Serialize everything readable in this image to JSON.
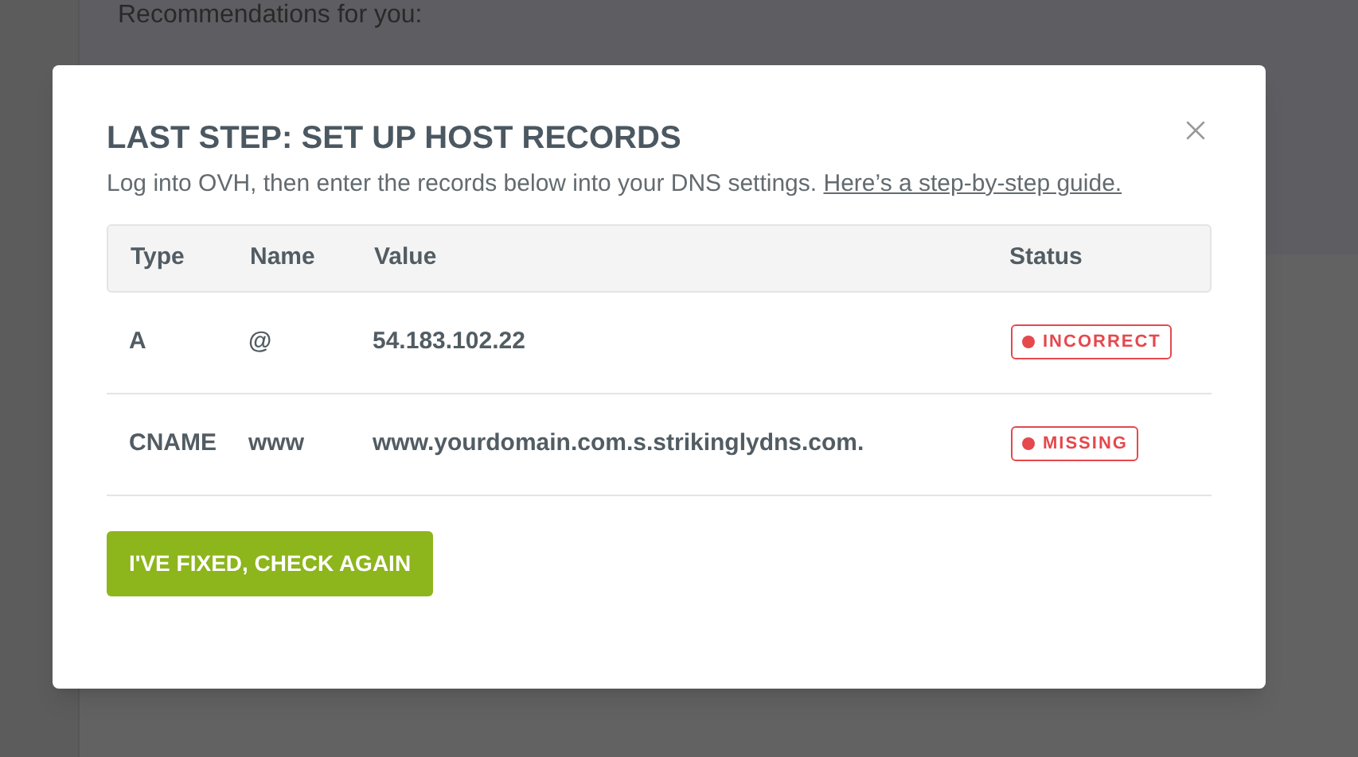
{
  "background": {
    "heading": "Recommendations for you:"
  },
  "dialog": {
    "title": "LAST STEP: SET UP HOST RECORDS",
    "description": "Log into OVH, then enter the records below into your DNS settings.",
    "guide_link": "Here’s a step-by-step guide.",
    "table": {
      "columns": [
        "Type",
        "Name",
        "Value",
        "Status"
      ],
      "rows": [
        {
          "type": "A",
          "name": "@",
          "value": "54.183.102.22",
          "status": "INCORRECT",
          "color": "#e5484d"
        },
        {
          "type": "CNAME",
          "name": "www",
          "value": "www.yourdomain.com.s.strikinglydns.com.",
          "status": "MISSING",
          "color": "#e5484d"
        }
      ]
    },
    "button": "I'VE FIXED, CHECK AGAIN"
  }
}
